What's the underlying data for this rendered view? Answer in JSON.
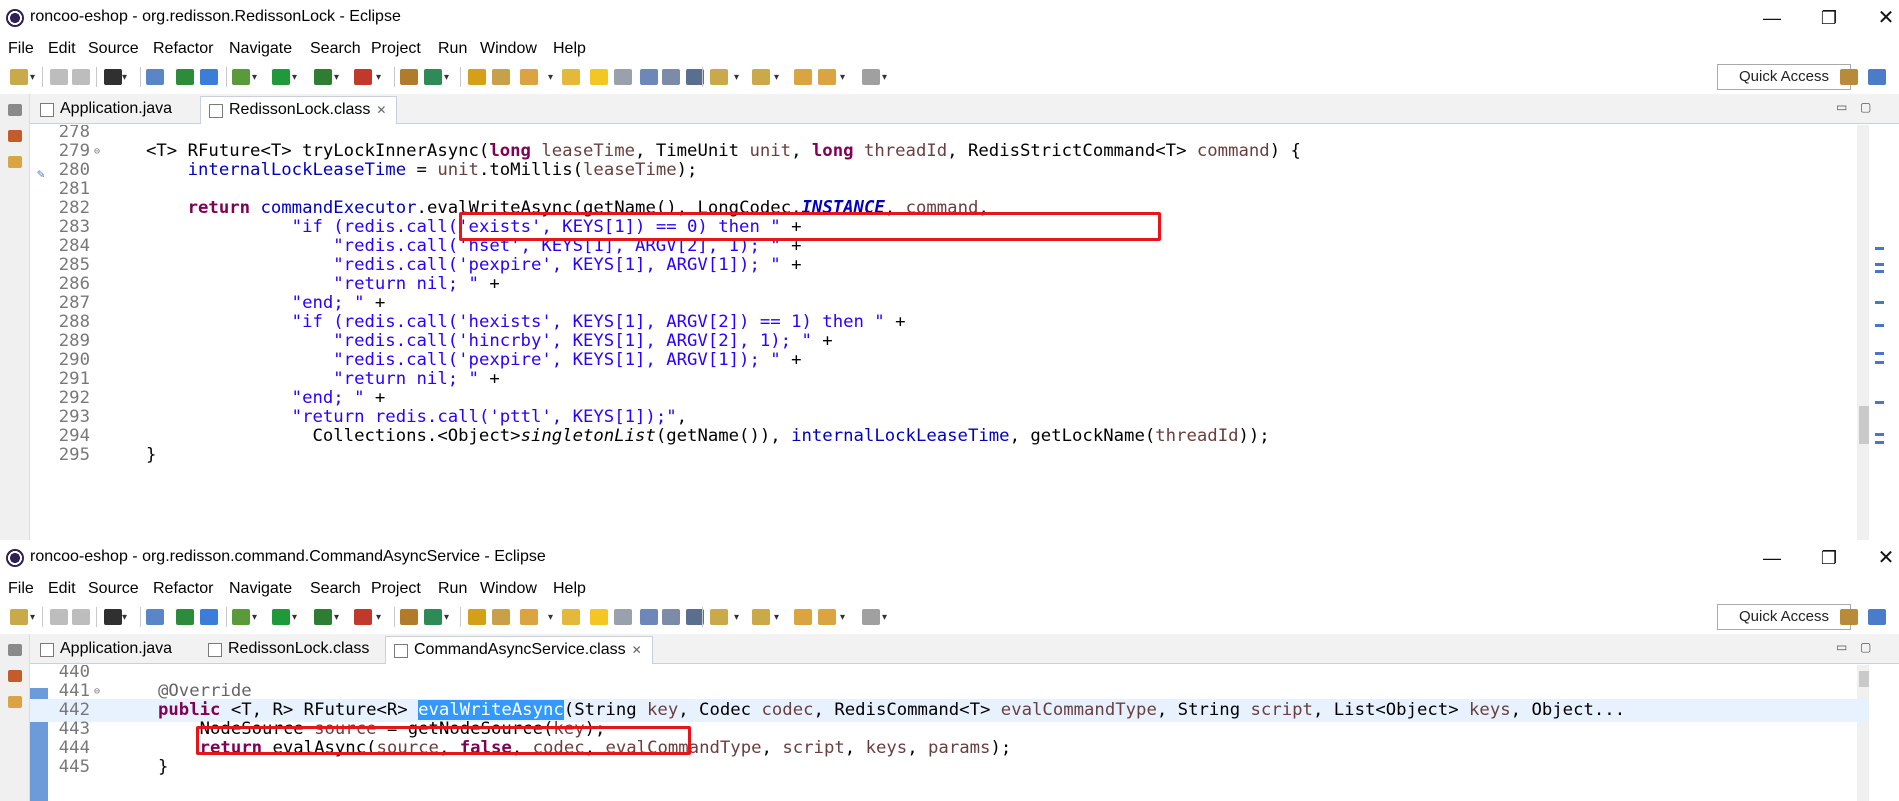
{
  "top_window": {
    "title": "roncoo-eshop - org.redisson.RedissonLock - Eclipse",
    "menu": [
      "File",
      "Edit",
      "Source",
      "Refactor",
      "Navigate",
      "Search",
      "Project",
      "Run",
      "Window",
      "Help"
    ],
    "quick_access": "Quick Access",
    "tabs": [
      {
        "label": "Application.java",
        "active": false,
        "closable": false
      },
      {
        "label": "RedissonLock.class",
        "active": true,
        "closable": true
      }
    ],
    "lines": [
      {
        "no": "278",
        "fold": "",
        "code": [
          [
            "",
            ""
          ]
        ]
      },
      {
        "no": "279",
        "fold": "⊖",
        "code": [
          [
            "",
            "<T> RFuture<T> tryLockInnerAsync("
          ],
          [
            "kw",
            "long"
          ],
          [
            "",
            " "
          ],
          [
            "lvar",
            "leaseTime"
          ],
          [
            "",
            ", TimeUnit "
          ],
          [
            "lvar",
            "unit"
          ],
          [
            "",
            ", "
          ],
          [
            "kw",
            "long"
          ],
          [
            "",
            " "
          ],
          [
            "lvar",
            "threadId"
          ],
          [
            "",
            ", RedisStrictCommand<T> "
          ],
          [
            "lvar",
            "command"
          ],
          [
            "",
            ") {"
          ]
        ]
      },
      {
        "no": "280",
        "fold": "",
        "code": [
          [
            "",
            "    "
          ],
          [
            "fld",
            "internalLockLeaseTime"
          ],
          [
            "",
            " = "
          ],
          [
            "lvar",
            "unit"
          ],
          [
            "",
            ".toMillis("
          ],
          [
            "lvar",
            "leaseTime"
          ],
          [
            "",
            ");"
          ]
        ]
      },
      {
        "no": "281",
        "fold": "",
        "code": [
          [
            "",
            ""
          ]
        ]
      },
      {
        "no": "282",
        "fold": "",
        "code": [
          [
            "",
            "    "
          ],
          [
            "kw",
            "return"
          ],
          [
            "",
            " "
          ],
          [
            "fld",
            "commandExecutor"
          ],
          [
            "",
            ".evalWriteAsync(getName(), LongCodec."
          ],
          [
            "cst",
            "INSTANCE"
          ],
          [
            "",
            ", "
          ],
          [
            "lvar",
            "command"
          ],
          [
            "",
            ","
          ]
        ]
      },
      {
        "no": "283",
        "fold": "",
        "code": [
          [
            "",
            "              "
          ],
          [
            "str",
            "\"if (redis.call('exists', KEYS[1]) == 0) then \""
          ],
          [
            "",
            " +"
          ]
        ]
      },
      {
        "no": "284",
        "fold": "",
        "code": [
          [
            "",
            "                  "
          ],
          [
            "str",
            "\"redis.call('hset', KEYS[1], ARGV[2], 1); \""
          ],
          [
            "",
            " +"
          ]
        ]
      },
      {
        "no": "285",
        "fold": "",
        "code": [
          [
            "",
            "                  "
          ],
          [
            "str",
            "\"redis.call('pexpire', KEYS[1], ARGV[1]); \""
          ],
          [
            "",
            " +"
          ]
        ]
      },
      {
        "no": "286",
        "fold": "",
        "code": [
          [
            "",
            "                  "
          ],
          [
            "str",
            "\"return nil; \""
          ],
          [
            "",
            " +"
          ]
        ]
      },
      {
        "no": "287",
        "fold": "",
        "code": [
          [
            "",
            "              "
          ],
          [
            "str",
            "\"end; \""
          ],
          [
            "",
            " +"
          ]
        ]
      },
      {
        "no": "288",
        "fold": "",
        "code": [
          [
            "",
            "              "
          ],
          [
            "str",
            "\"if (redis.call('hexists', KEYS[1], ARGV[2]) == 1) then \""
          ],
          [
            "",
            " +"
          ]
        ]
      },
      {
        "no": "289",
        "fold": "",
        "code": [
          [
            "",
            "                  "
          ],
          [
            "str",
            "\"redis.call('hincrby', KEYS[1], ARGV[2], 1); \""
          ],
          [
            "",
            " +"
          ]
        ]
      },
      {
        "no": "290",
        "fold": "",
        "code": [
          [
            "",
            "                  "
          ],
          [
            "str",
            "\"redis.call('pexpire', KEYS[1], ARGV[1]); \""
          ],
          [
            "",
            " +"
          ]
        ]
      },
      {
        "no": "291",
        "fold": "",
        "code": [
          [
            "",
            "                  "
          ],
          [
            "str",
            "\"return nil; \""
          ],
          [
            "",
            " +"
          ]
        ]
      },
      {
        "no": "292",
        "fold": "",
        "code": [
          [
            "",
            "              "
          ],
          [
            "str",
            "\"end; \""
          ],
          [
            "",
            " +"
          ]
        ]
      },
      {
        "no": "293",
        "fold": "",
        "code": [
          [
            "",
            "              "
          ],
          [
            "str",
            "\"return redis.call('pttl', KEYS[1]);\""
          ],
          [
            "",
            ","
          ]
        ]
      },
      {
        "no": "294",
        "fold": "",
        "code": [
          [
            "",
            "                Collections.<Object>"
          ],
          [
            "ital",
            "singletonList"
          ],
          [
            "",
            "(getName()), "
          ],
          [
            "fld",
            "internalLockLeaseTime"
          ],
          [
            "",
            ", getLockName("
          ],
          [
            "lvar",
            "threadId"
          ],
          [
            "",
            "));"
          ]
        ]
      },
      {
        "no": "295",
        "fold": "",
        "code": [
          [
            "",
            "}"
          ]
        ]
      }
    ]
  },
  "bottom_window": {
    "title": "roncoo-eshop - org.redisson.command.CommandAsyncService - Eclipse",
    "menu": [
      "File",
      "Edit",
      "Source",
      "Refactor",
      "Navigate",
      "Search",
      "Project",
      "Run",
      "Window",
      "Help"
    ],
    "quick_access": "Quick Access",
    "tabs": [
      {
        "label": "Application.java",
        "active": false,
        "closable": false
      },
      {
        "label": "RedissonLock.class",
        "active": false,
        "closable": false
      },
      {
        "label": "CommandAsyncService.class",
        "active": true,
        "closable": true
      }
    ],
    "lines": [
      {
        "no": "440",
        "fold": "",
        "code": [
          [
            "",
            ""
          ]
        ]
      },
      {
        "no": "441",
        "fold": "⊖",
        "code": [
          [
            "ann",
            "@Override"
          ]
        ]
      },
      {
        "no": "442",
        "fold": "",
        "code": [
          [
            "kw",
            "public"
          ],
          [
            "",
            " <T, R> RFuture<R> "
          ],
          [
            "sel",
            "evalWriteAsync"
          ],
          [
            "",
            "(String "
          ],
          [
            "lvar",
            "key"
          ],
          [
            "",
            ", Codec "
          ],
          [
            "lvar",
            "codec"
          ],
          [
            "",
            ", RedisCommand<T> "
          ],
          [
            "lvar",
            "evalCommandType"
          ],
          [
            "",
            ", String "
          ],
          [
            "lvar",
            "script"
          ],
          [
            "",
            ", List<Object> "
          ],
          [
            "lvar",
            "keys"
          ],
          [
            "",
            ", Object..."
          ]
        ]
      },
      {
        "no": "443",
        "fold": "",
        "code": [
          [
            "",
            "    NodeSource "
          ],
          [
            "lvar",
            "source"
          ],
          [
            "",
            " = getNodeSource("
          ],
          [
            "lvar",
            "key"
          ],
          [
            "",
            ");"
          ]
        ]
      },
      {
        "no": "444",
        "fold": "",
        "code": [
          [
            "",
            "    "
          ],
          [
            "kw",
            "return"
          ],
          [
            "",
            " evalAsync("
          ],
          [
            "lvar",
            "source"
          ],
          [
            "",
            ", "
          ],
          [
            "kw",
            "false"
          ],
          [
            "",
            ", "
          ],
          [
            "lvar",
            "codec"
          ],
          [
            "",
            ", "
          ],
          [
            "lvar",
            "evalCommandType"
          ],
          [
            "",
            ", "
          ],
          [
            "lvar",
            "script"
          ],
          [
            "",
            ", "
          ],
          [
            "lvar",
            "keys"
          ],
          [
            "",
            ", "
          ],
          [
            "lvar",
            "params"
          ],
          [
            "",
            ");"
          ]
        ]
      },
      {
        "no": "445",
        "fold": "",
        "code": [
          [
            "",
            "}"
          ]
        ]
      }
    ]
  },
  "colors": {
    "keyword": "#7f0055",
    "field": "#0000c0",
    "string": "#2a00ff",
    "local_var": "#6a3e3e",
    "highlight_box": "#e8141c",
    "selection": "#3399ff"
  }
}
